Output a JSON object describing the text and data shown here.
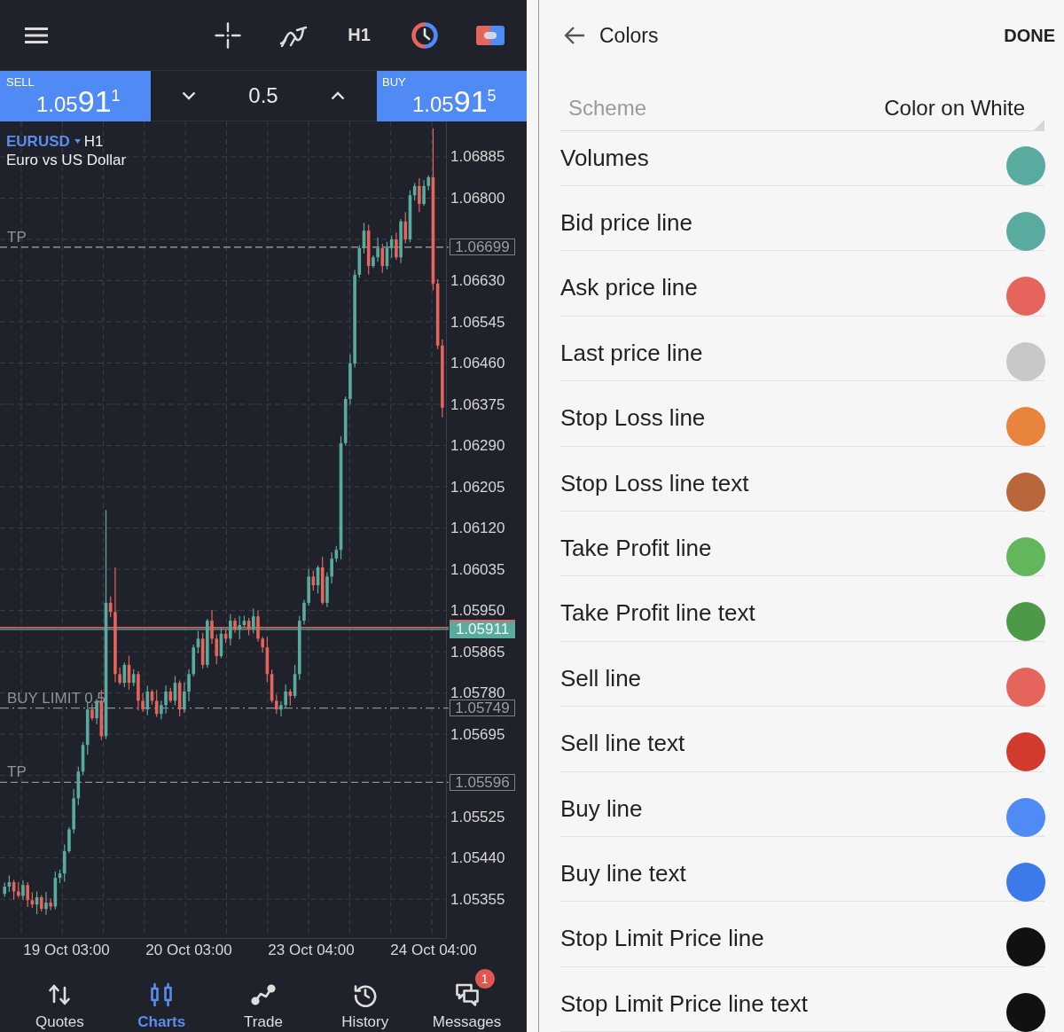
{
  "toolbar": {
    "timeframe": "H1"
  },
  "trade_bar": {
    "sell": {
      "label": "SELL",
      "price": "1.05",
      "pips": "91",
      "point": "1"
    },
    "volume": "0.5",
    "buy": {
      "label": "BUY",
      "price": "1.05",
      "pips": "91",
      "point": "5"
    }
  },
  "chart": {
    "symbol": "EURUSD",
    "timeframe": "H1",
    "description": "Euro vs US Dollar",
    "chart_data": {
      "type": "candlestick",
      "grid": true,
      "ylim": [
        1.05275,
        1.06958
      ],
      "yticks": [
        {
          "value": 1.06885,
          "label": "1.06885"
        },
        {
          "value": 1.068,
          "label": "1.06800"
        },
        {
          "value": 1.0663,
          "label": "1.06630"
        },
        {
          "value": 1.06545,
          "label": "1.06545"
        },
        {
          "value": 1.0646,
          "label": "1.06460"
        },
        {
          "value": 1.06375,
          "label": "1.06375"
        },
        {
          "value": 1.0629,
          "label": "1.06290"
        },
        {
          "value": 1.06205,
          "label": "1.06205"
        },
        {
          "value": 1.0612,
          "label": "1.06120"
        },
        {
          "value": 1.06035,
          "label": "1.06035"
        },
        {
          "value": 1.0595,
          "label": "1.05950"
        },
        {
          "value": 1.05865,
          "label": "1.05865"
        },
        {
          "value": 1.0578,
          "label": "1.05780"
        },
        {
          "value": 1.05695,
          "label": "1.05695"
        },
        {
          "value": 1.05525,
          "label": "1.05525"
        },
        {
          "value": 1.0544,
          "label": "1.05440"
        },
        {
          "value": 1.05355,
          "label": "1.05355"
        }
      ],
      "ref_lines": [
        {
          "axis": "y",
          "value": 1.05915,
          "color": "#e5645c"
        },
        {
          "axis": "y",
          "value": 1.05911,
          "color": "#5aab9f",
          "label": "1.05911"
        }
      ],
      "ohlc": [
        [
          1.05366,
          1.05389,
          1.0536,
          1.05381
        ],
        [
          1.05381,
          1.05404,
          1.0537,
          1.0539
        ],
        [
          1.0539,
          1.05395,
          1.05354,
          1.05371
        ],
        [
          1.05371,
          1.0539,
          1.05358,
          1.05362
        ],
        [
          1.05362,
          1.05394,
          1.05353,
          1.05384
        ],
        [
          1.05384,
          1.0539,
          1.05339,
          1.05353
        ],
        [
          1.05353,
          1.05369,
          1.05337,
          1.05344
        ],
        [
          1.05344,
          1.05371,
          1.05324,
          1.05359
        ],
        [
          1.05359,
          1.05363,
          1.0533,
          1.05335
        ],
        [
          1.05335,
          1.0537,
          1.05323,
          1.05348
        ],
        [
          1.05348,
          1.05357,
          1.05332,
          1.0534
        ],
        [
          1.0534,
          1.05412,
          1.05334,
          1.05399
        ],
        [
          1.05399,
          1.05416,
          1.05388,
          1.05408
        ],
        [
          1.05408,
          1.05468,
          1.05391,
          1.05454
        ],
        [
          1.05454,
          1.05504,
          1.0545,
          1.05499
        ],
        [
          1.05499,
          1.05582,
          1.0549,
          1.05563
        ],
        [
          1.05563,
          1.05628,
          1.05549,
          1.05618
        ],
        [
          1.05618,
          1.05679,
          1.05611,
          1.05673
        ],
        [
          1.05673,
          1.05762,
          1.05653,
          1.05746
        ],
        [
          1.05746,
          1.05758,
          1.05723,
          1.05728
        ],
        [
          1.05728,
          1.05768,
          1.05716,
          1.05764
        ],
        [
          1.05764,
          1.05786,
          1.05683,
          1.05691
        ],
        [
          1.05691,
          1.06157,
          1.05685,
          1.05966
        ],
        [
          1.05966,
          1.05979,
          1.05936,
          1.05947
        ],
        [
          1.05947,
          1.06039,
          1.05802,
          1.05819
        ],
        [
          1.05819,
          1.05833,
          1.05797,
          1.05801
        ],
        [
          1.05801,
          1.05843,
          1.05792,
          1.05838
        ],
        [
          1.05838,
          1.05857,
          1.05787,
          1.05801
        ],
        [
          1.05801,
          1.05829,
          1.05794,
          1.05819
        ],
        [
          1.05819,
          1.05825,
          1.05744,
          1.05764
        ],
        [
          1.05764,
          1.0578,
          1.05741,
          1.05746
        ],
        [
          1.05746,
          1.05795,
          1.05734,
          1.05783
        ],
        [
          1.05783,
          1.05787,
          1.05756,
          1.05764
        ],
        [
          1.05764,
          1.05786,
          1.05731,
          1.05737
        ],
        [
          1.05737,
          1.05764,
          1.05726,
          1.05755
        ],
        [
          1.05755,
          1.05796,
          1.05738,
          1.05783
        ],
        [
          1.05783,
          1.05791,
          1.0576,
          1.05764
        ],
        [
          1.05764,
          1.05815,
          1.05755,
          1.05801
        ],
        [
          1.05801,
          1.05806,
          1.05732,
          1.05746
        ],
        [
          1.05746,
          1.05802,
          1.05739,
          1.05783
        ],
        [
          1.05783,
          1.05829,
          1.05763,
          1.05819
        ],
        [
          1.05819,
          1.0588,
          1.05814,
          1.05874
        ],
        [
          1.05874,
          1.05908,
          1.05862,
          1.05892
        ],
        [
          1.05892,
          1.05904,
          1.0583,
          1.05838
        ],
        [
          1.05838,
          1.05933,
          1.05832,
          1.05929
        ],
        [
          1.05929,
          1.05951,
          1.05881,
          1.05892
        ],
        [
          1.05892,
          1.05901,
          1.05839,
          1.05856
        ],
        [
          1.05856,
          1.05915,
          1.05852,
          1.05902
        ],
        [
          1.05902,
          1.0591,
          1.05883,
          1.05892
        ],
        [
          1.05892,
          1.05943,
          1.05878,
          1.05929
        ],
        [
          1.05929,
          1.05934,
          1.05904,
          1.05911
        ],
        [
          1.05911,
          1.05939,
          1.05891,
          1.0592
        ],
        [
          1.0592,
          1.05939,
          1.05915,
          1.05929
        ],
        [
          1.05929,
          1.05935,
          1.05899,
          1.05911
        ],
        [
          1.05911,
          1.05954,
          1.05903,
          1.05938
        ],
        [
          1.05938,
          1.0595,
          1.05886,
          1.05892
        ],
        [
          1.05892,
          1.05896,
          1.05863,
          1.05874
        ],
        [
          1.05874,
          1.05896,
          1.05802,
          1.05819
        ],
        [
          1.05819,
          1.05828,
          1.0576,
          1.05764
        ],
        [
          1.05764,
          1.05777,
          1.05737,
          1.05746
        ],
        [
          1.05746,
          1.05763,
          1.05732,
          1.05755
        ],
        [
          1.05755,
          1.05797,
          1.05748,
          1.05783
        ],
        [
          1.05783,
          1.05788,
          1.05754,
          1.05774
        ],
        [
          1.05774,
          1.05838,
          1.05769,
          1.05819
        ],
        [
          1.05819,
          1.05939,
          1.05807,
          1.05929
        ],
        [
          1.05929,
          1.05972,
          1.05921,
          1.05966
        ],
        [
          1.05966,
          1.06036,
          1.0596,
          1.0602
        ],
        [
          1.0602,
          1.06032,
          1.05991,
          1.06002
        ],
        [
          1.06002,
          1.06043,
          1.05985,
          1.06039
        ],
        [
          1.06039,
          1.06061,
          1.05962,
          1.05966
        ],
        [
          1.05966,
          1.06029,
          1.05957,
          1.0602
        ],
        [
          1.0602,
          1.0607,
          1.06006,
          1.06057
        ],
        [
          1.06057,
          1.06083,
          1.0605,
          1.06075
        ],
        [
          1.06075,
          1.06309,
          1.06055,
          1.06295
        ],
        [
          1.06295,
          1.06391,
          1.0629,
          1.06386
        ],
        [
          1.06386,
          1.06478,
          1.06374,
          1.06459
        ],
        [
          1.06459,
          1.06652,
          1.06451,
          1.06642
        ],
        [
          1.06642,
          1.06703,
          1.06636,
          1.06697
        ],
        [
          1.06697,
          1.06749,
          1.06686,
          1.06733
        ],
        [
          1.06733,
          1.06745,
          1.06643,
          1.0666
        ],
        [
          1.0666,
          1.06682,
          1.06656,
          1.06678
        ],
        [
          1.06678,
          1.06719,
          1.06669,
          1.06697
        ],
        [
          1.06697,
          1.06706,
          1.06646,
          1.0666
        ],
        [
          1.0666,
          1.0671,
          1.06653,
          1.06697
        ],
        [
          1.06697,
          1.06723,
          1.06677,
          1.06715
        ],
        [
          1.06715,
          1.06729,
          1.06673,
          1.06678
        ],
        [
          1.06678,
          1.06757,
          1.06666,
          1.06752
        ],
        [
          1.06752,
          1.06771,
          1.06707,
          1.06715
        ],
        [
          1.06715,
          1.06816,
          1.06709,
          1.06806
        ],
        [
          1.06806,
          1.06831,
          1.06795,
          1.06825
        ],
        [
          1.06825,
          1.06841,
          1.06771,
          1.06788
        ],
        [
          1.06788,
          1.06837,
          1.06784,
          1.06825
        ],
        [
          1.06825,
          1.06847,
          1.06816,
          1.06843
        ],
        [
          1.06843,
          1.06944,
          1.0661,
          1.06624
        ],
        [
          1.06624,
          1.06633,
          1.06489,
          1.06496
        ],
        [
          1.06496,
          1.06509,
          1.06348,
          1.06368
        ]
      ]
    },
    "levels": [
      {
        "kind": "take_profit",
        "label": "TP",
        "price": "1.06699"
      },
      {
        "kind": "pending_order",
        "label": "BUY LIMIT 0.5",
        "price": "1.05749"
      },
      {
        "kind": "take_profit",
        "label": "TP",
        "price": "1.05596"
      }
    ],
    "time_labels": [
      "19 Oct 03:00",
      "20 Oct 03:00",
      "23 Oct 04:00",
      "24 Oct 04:00"
    ]
  },
  "bottom_nav": [
    {
      "label": "Quotes",
      "selected": false
    },
    {
      "label": "Charts",
      "selected": true
    },
    {
      "label": "Trade",
      "selected": false
    },
    {
      "label": "History",
      "selected": false
    },
    {
      "label": "Messages",
      "selected": false,
      "badge": "1"
    }
  ],
  "colors_screen": {
    "title": "Colors",
    "action": "DONE",
    "scheme": {
      "label": "Scheme",
      "value": "Color on White"
    },
    "items": [
      {
        "name": "Volumes",
        "color": "#5aab9f"
      },
      {
        "name": "Bid price line",
        "color": "#5aab9f"
      },
      {
        "name": "Ask price line",
        "color": "#e5645c"
      },
      {
        "name": "Last price line",
        "color": "#c8c8c8"
      },
      {
        "name": "Stop Loss line",
        "color": "#e8843c"
      },
      {
        "name": "Stop Loss line text",
        "color": "#b8663a"
      },
      {
        "name": "Take Profit line",
        "color": "#62b65c"
      },
      {
        "name": "Take Profit line text",
        "color": "#4c9a48"
      },
      {
        "name": "Sell line",
        "color": "#e5645c"
      },
      {
        "name": "Sell line text",
        "color": "#d23a2e"
      },
      {
        "name": "Buy line",
        "color": "#4f8af5"
      },
      {
        "name": "Buy line text",
        "color": "#3b7ae8"
      },
      {
        "name": "Stop Limit Price line",
        "color": "#111111"
      },
      {
        "name": "Stop Limit Price line text",
        "color": "#111111"
      }
    ]
  }
}
